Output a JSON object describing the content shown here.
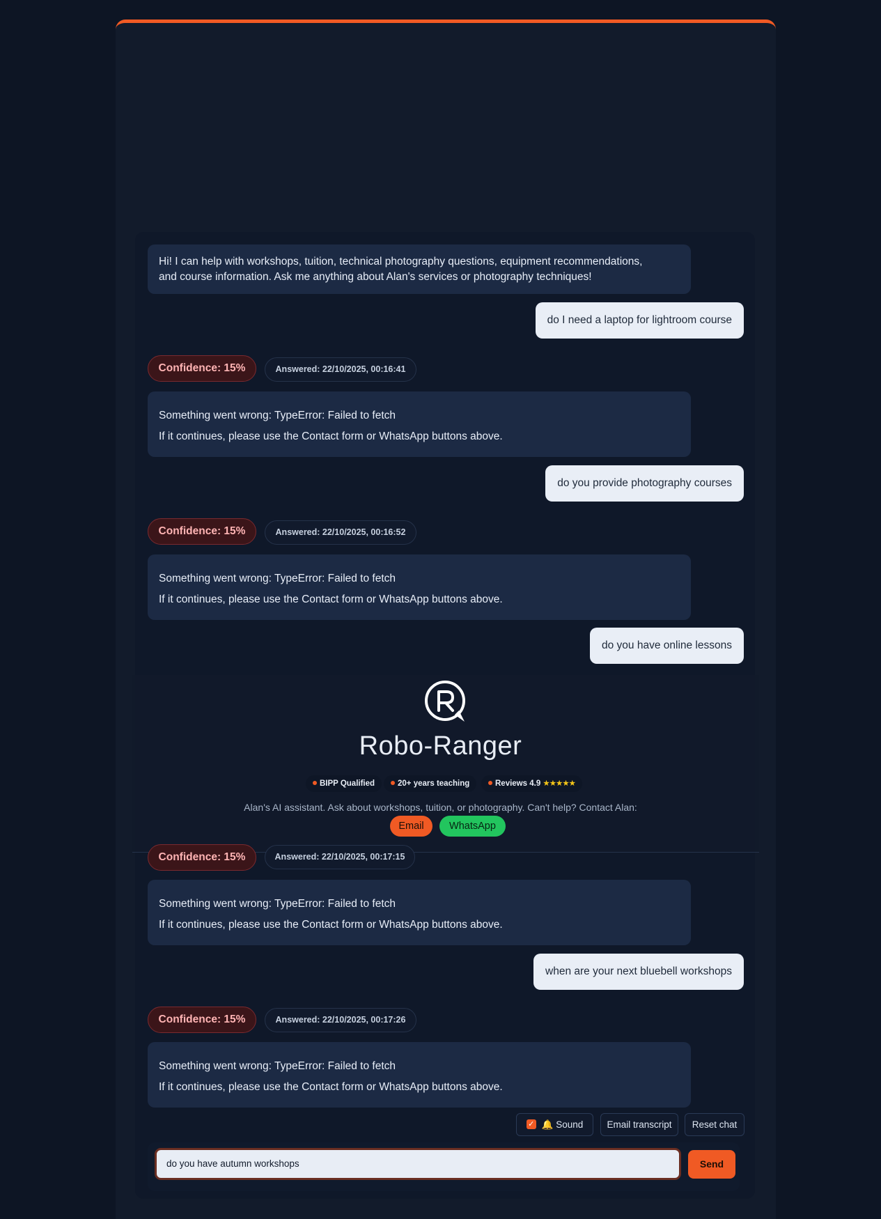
{
  "welcome": {
    "line1": "Hi! I can help with workshops, tuition, technical photography questions, equipment recommendations,",
    "line2": "and course information. Ask me anything about Alan's services or photography techniques!"
  },
  "messages": [
    {
      "question": "do I need a laptop for lightroom course",
      "confidence": "Confidence: 15%",
      "answered": "Answered: 22/10/2025, 00:16:41",
      "error": "Something went wrong: TypeError: Failed to fetch",
      "hint": "If it continues, please use the Contact form or WhatsApp buttons above."
    },
    {
      "question": "do you provide photography courses",
      "confidence": "Confidence: 15%",
      "answered": "Answered: 22/10/2025, 00:16:52",
      "error": "Something went wrong: TypeError: Failed to fetch",
      "hint": "If it continues, please use the Contact form or WhatsApp buttons above."
    },
    {
      "question": "do you have online lessons",
      "confidence": "Confidence: 15%",
      "answered": "Answered: 22/10/2025, 00:17:15",
      "error": "Something went wrong: TypeError: Failed to fetch",
      "hint": "If it continues, please use the Contact form or WhatsApp buttons above."
    },
    {
      "question": "when are your next bluebell workshops",
      "confidence": "Confidence: 15%",
      "answered": "Answered: 22/10/2025, 00:17:26",
      "error": "Something went wrong: TypeError: Failed to fetch",
      "hint": "If it continues, please use the Contact form or WhatsApp buttons above."
    }
  ],
  "header": {
    "brand": "Robo-Ranger",
    "badges": [
      "BIPP Qualified",
      "20+ years teaching",
      "Reviews 4.9"
    ],
    "stars": "★★★★★",
    "intro": "Alan's AI assistant. Ask about workshops, tuition, or photography. Can't help? Contact Alan:",
    "email": "Email",
    "whatsapp": "WhatsApp"
  },
  "controls": {
    "sound_label": "Sound",
    "sound_icon": "🔔",
    "sound_checked": true,
    "email_transcript": "Email transcript",
    "reset_chat": "Reset chat"
  },
  "composer": {
    "value": "do you have autumn workshops",
    "send": "Send"
  },
  "colors": {
    "accent": "#f05a24",
    "whatsapp": "#22c55e",
    "background": "#0d1524"
  }
}
